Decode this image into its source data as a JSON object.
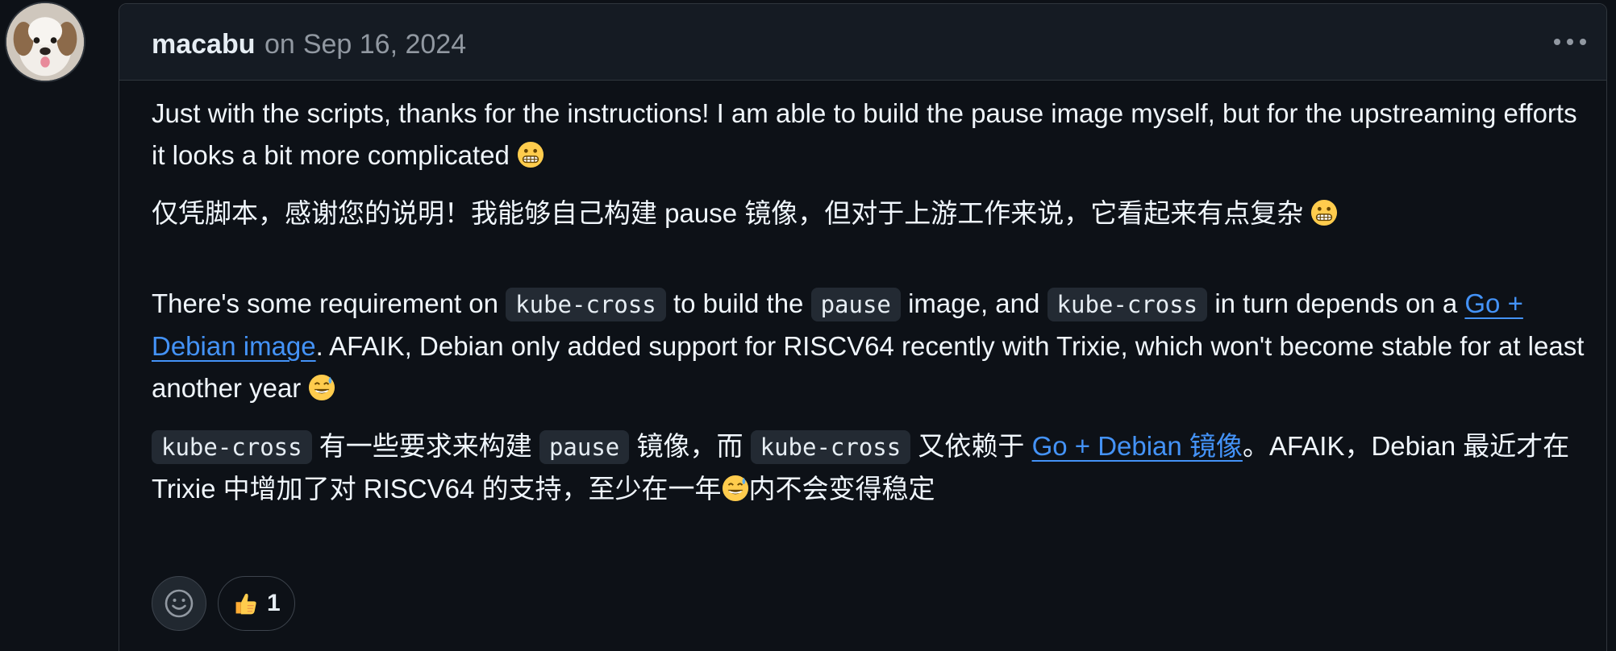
{
  "comment": {
    "author": "macabu",
    "date_prefix": "on",
    "date": "Sep 16, 2024",
    "menu_icon": "kebab-horizontal-icon"
  },
  "body": {
    "p1": "Just with the scripts, thanks for the instructions! I am able to build the pause image myself, but for the upstreaming efforts it looks a bit more complicated",
    "p2": "仅凭脚本，感谢您的说明！我能够自己构建 pause 镜像，但对于上游工作来说，它看起来有点复杂",
    "p3": {
      "t1": "There's some requirement on",
      "c1": "kube-cross",
      "t2": "to build the",
      "c2": "pause",
      "t3": "image, and",
      "c3": "kube-cross",
      "t4": "in turn depends on a",
      "link": "Go + Debian image",
      "t5": ". AFAIK, Debian only added support for RISCV64 recently with Trixie, which won't become stable for at least another year"
    },
    "p4": {
      "c1": "kube-cross",
      "t1": "有一些要求来构建",
      "c2": "pause",
      "t2": "镜像，而",
      "c3": "kube-cross",
      "t3": "又依赖于",
      "link": "Go + Debian 镜像",
      "t4": "。AFAIK，Debian 最近才在 Trixie 中增加了对 RISCV64 的支持，至少在一年",
      "t5": "内不会变得稳定"
    },
    "emoji_grimace": "grimacing-face-emoji",
    "emoji_sweat": "grinning-sweat-emoji"
  },
  "reactions": {
    "add_icon": "smiley-icon",
    "thumbs_up_icon": "thumbs-up-emoji",
    "thumbs_up_count": "1"
  },
  "colors": {
    "background": "#0d1117",
    "header": "#151b23",
    "border": "#30363d",
    "link": "#4493f8",
    "muted": "#9198a1"
  }
}
